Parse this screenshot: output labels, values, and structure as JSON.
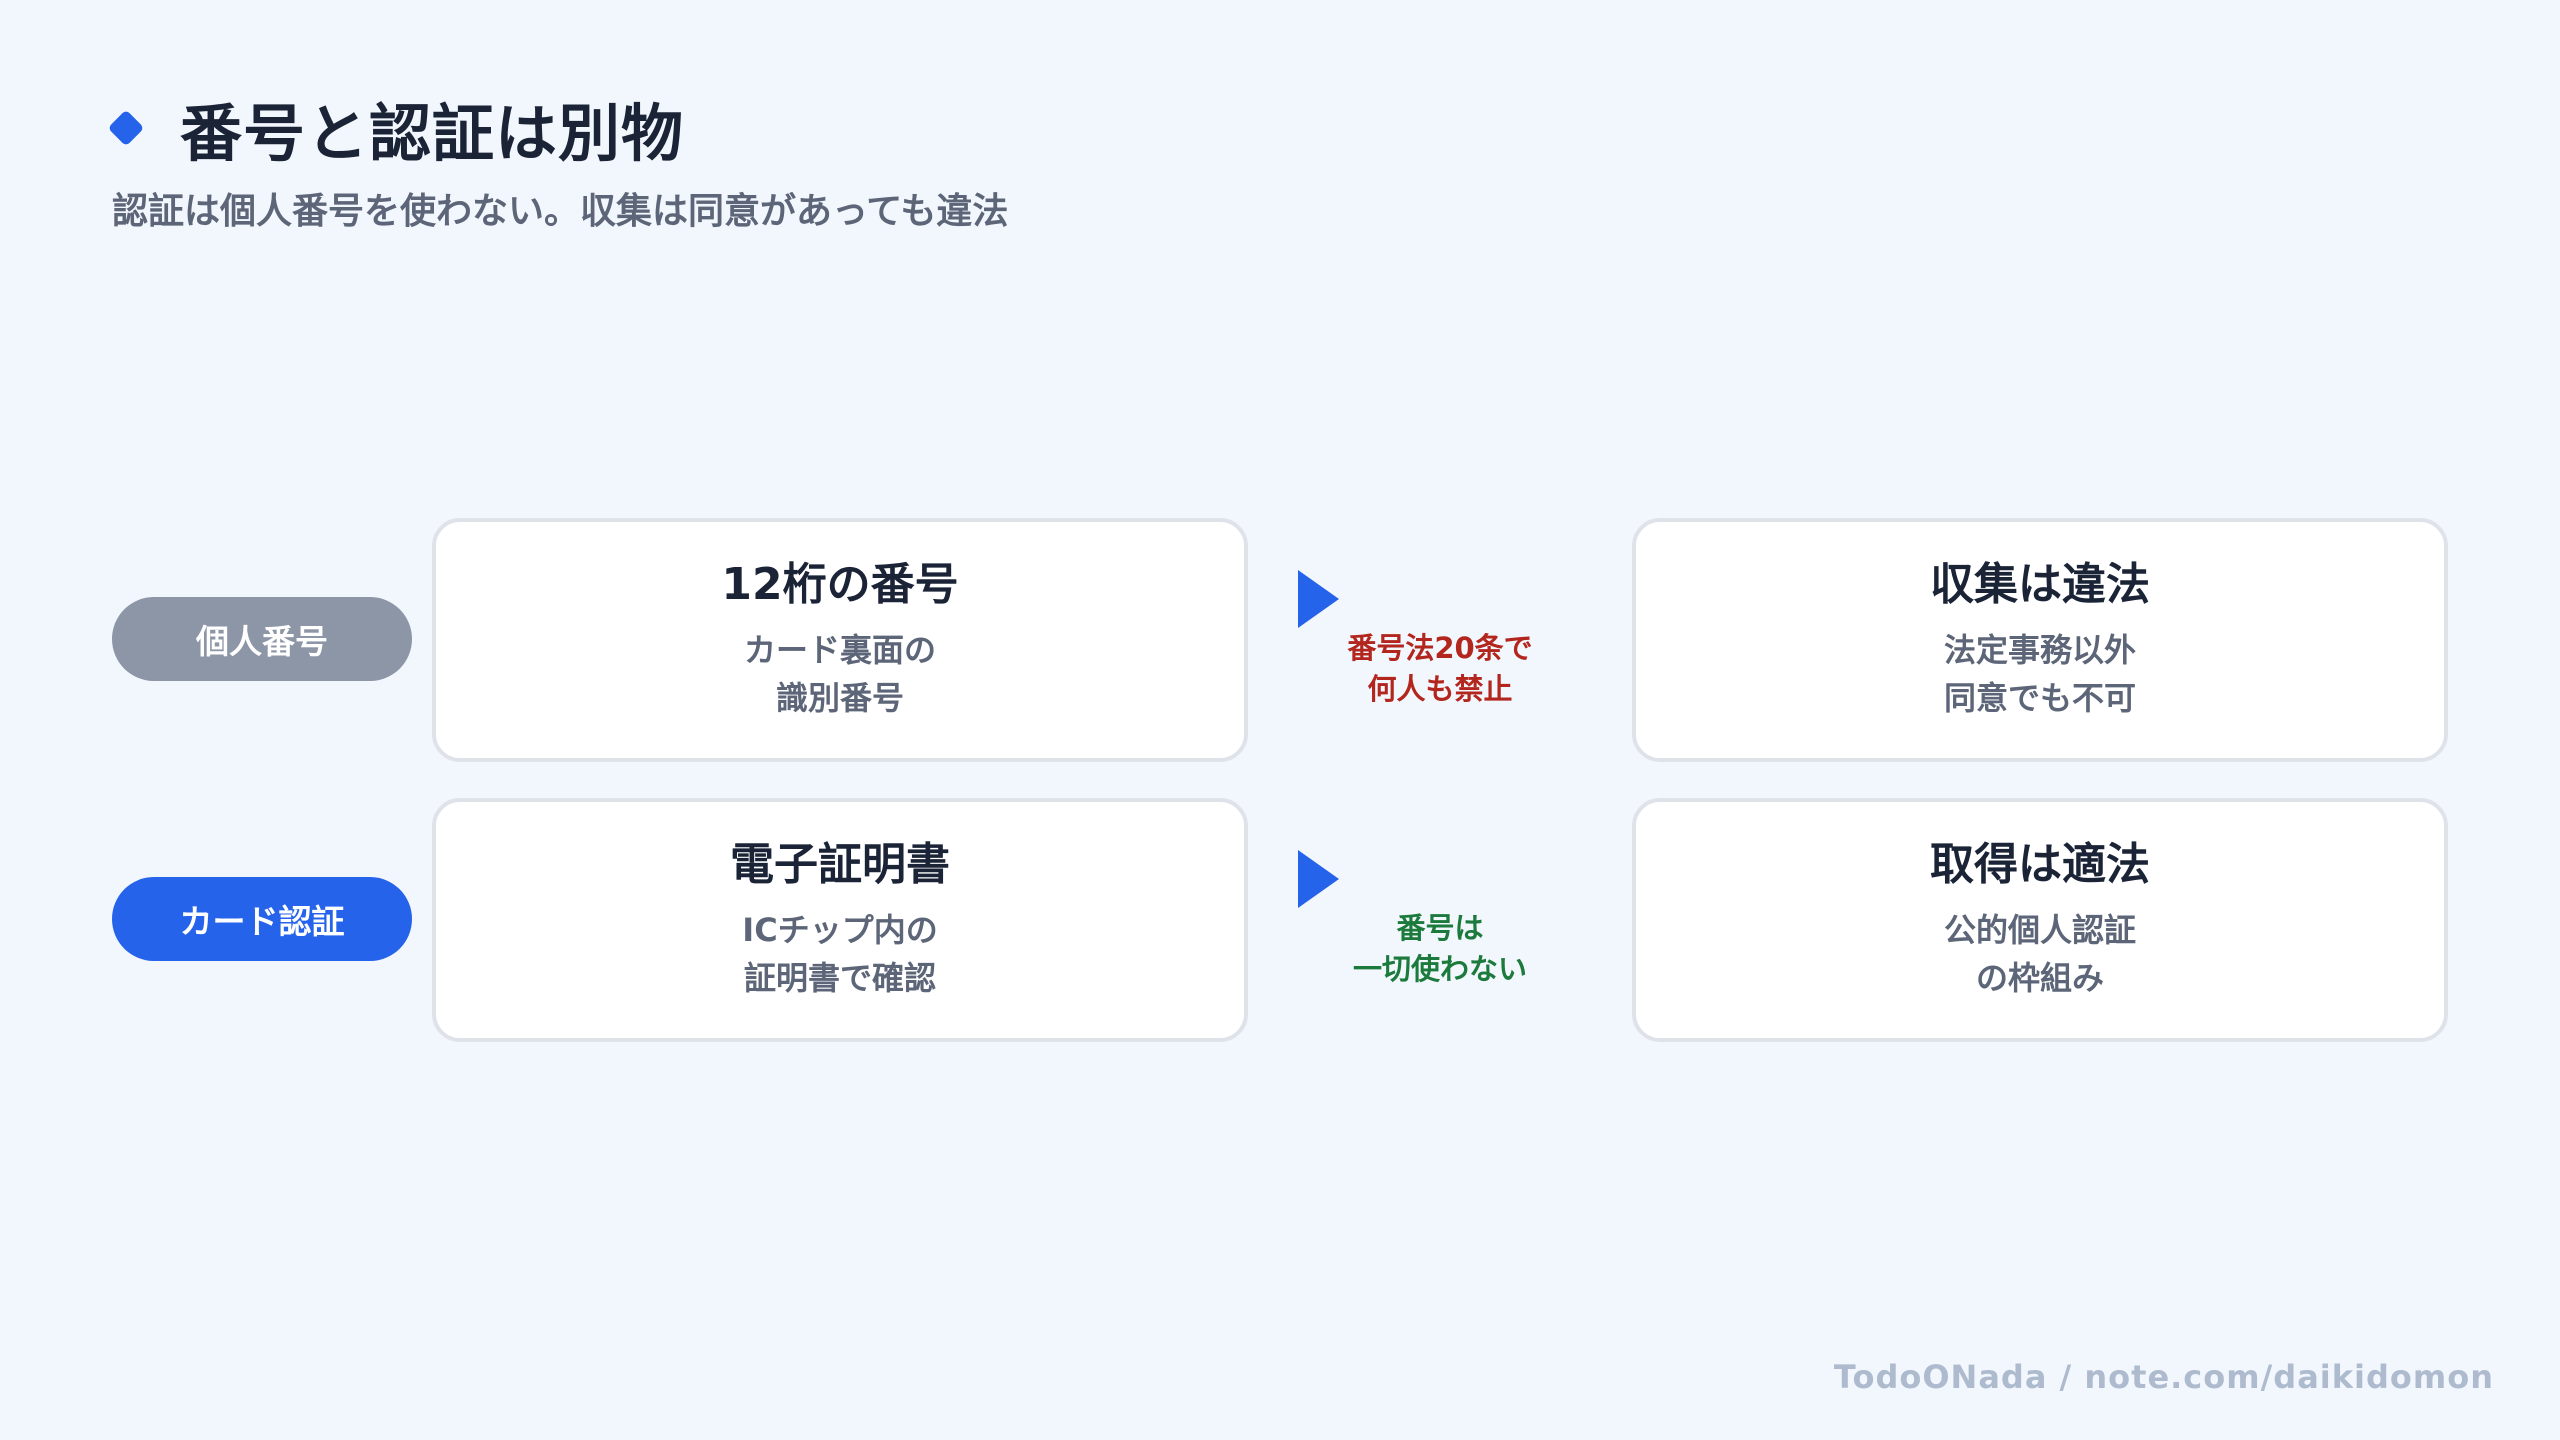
{
  "header": {
    "title": "番号と認証は別物",
    "subtitle": "認証は個人番号を使わない。収集は同意があっても違法"
  },
  "rows": [
    {
      "label": "個人番号",
      "label_color": "#8d96a7",
      "left_card": {
        "heading": "12桁の番号",
        "body": "カード裏面の\n識別番号"
      },
      "note": "番号法20条で\n何人も禁止",
      "note_color": "#b3261e",
      "right_card": {
        "heading": "収集は違法",
        "body": "法定事務以外\n同意でも不可"
      }
    },
    {
      "label": "カード認証",
      "label_color": "#2563eb",
      "left_card": {
        "heading": "電子証明書",
        "body": "ICチップ内の\n証明書で確認"
      },
      "note": "番号は\n一切使わない",
      "note_color": "#1b7a3c",
      "right_card": {
        "heading": "取得は適法",
        "body": "公的個人認証\nの枠組み"
      }
    }
  ],
  "footer": "TodoONada / note.com/daikidomon",
  "colors": {
    "accent": "#2563eb",
    "background": "#f2f7fd",
    "card_border": "#dfe3e9"
  },
  "icons": {
    "title_marker": "diamond-icon",
    "flow_arrow": "arrow-right-icon"
  }
}
